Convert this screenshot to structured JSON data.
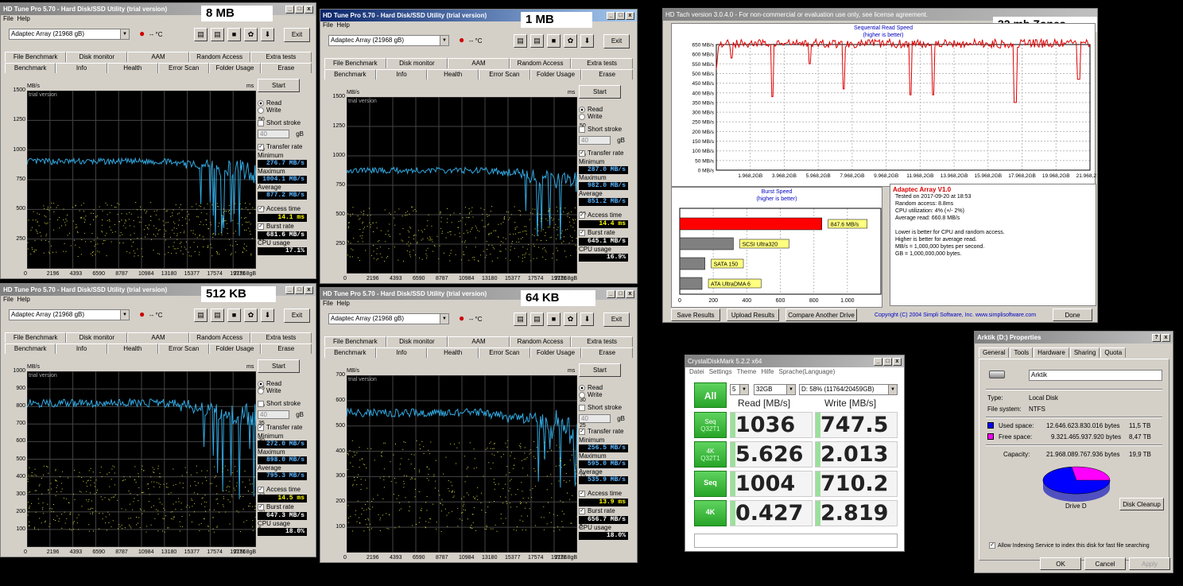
{
  "hdtune": {
    "menu_file": "File",
    "menu_help": "Help",
    "drive_select": "Adaptec Array (21968 gB)",
    "temp": "-- °C",
    "exit_label": "Exit",
    "tabs_top": [
      "File Benchmark",
      "Disk monitor",
      "AAM",
      "Random Access",
      "Extra tests"
    ],
    "tabs_bottom": [
      "Benchmark",
      "Info",
      "Health",
      "Error Scan",
      "Folder Usage",
      "Erase"
    ],
    "start_label": "Start",
    "read_label": "Read",
    "write_label": "Write",
    "short_stroke_label": "Short stroke",
    "stroke_value": "40",
    "stroke_unit": "gB",
    "transfer_rate_label": "Transfer rate",
    "minimum_label": "Minimum",
    "maximum_label": "Maximum",
    "average_label": "Average",
    "access_time_label": "Access time",
    "burst_rate_label": "Burst rate",
    "cpu_usage_label": "CPU usage",
    "trial_text": "trial version",
    "mbs_unit": "MB/s",
    "ms_unit": "ms",
    "x_ticks": [
      "0",
      "2196",
      "4393",
      "6590",
      "8787",
      "10984",
      "13180",
      "15377",
      "17574",
      "19771",
      "21968gB"
    ],
    "windows": [
      {
        "title": "HD Tune Pro 5.70 - Hard Disk/SSD Utility (trial version)",
        "label": "8 MB",
        "y_ticks": [
          "1500",
          "1250",
          "1000",
          "750",
          "500",
          "250"
        ],
        "ms_ticks": [
          "60",
          "50",
          "40",
          "30",
          "20",
          "10"
        ],
        "minimum": "276.7 MB/s",
        "maximum": "1004.1 MB/s",
        "average": "877.2 MB/s",
        "access": "14.1 ms",
        "burst": "681.6 MB/s",
        "cpu": "17.1%"
      },
      {
        "title": "HD Tune Pro 5.70 - Hard Disk/SSD Utility (trial version)",
        "label": "1 MB",
        "y_ticks": [
          "1500",
          "1250",
          "1000",
          "750",
          "500",
          "250"
        ],
        "ms_ticks": [
          "60",
          "50",
          "40",
          "30",
          "20",
          "10"
        ],
        "minimum": "287.0 MB/s",
        "maximum": "982.0 MB/s",
        "average": "851.2 MB/s",
        "access": "14.4 ms",
        "burst": "645.1 MB/s",
        "cpu": "16.9%"
      },
      {
        "title": "HD Tune Pro 5.70 - Hard Disk/SSD Utility (trial version)",
        "label": "512 KB",
        "y_ticks": [
          "1000",
          "900",
          "800",
          "700",
          "600",
          "500",
          "400",
          "300",
          "200",
          "100"
        ],
        "ms_ticks": [
          "50",
          "45",
          "40",
          "35",
          "30",
          "25",
          "20",
          "15",
          "10",
          "5"
        ],
        "minimum": "272.0 MB/s",
        "maximum": "898.0 MB/s",
        "average": "795.3 MB/s",
        "access": "14.5 ms",
        "burst": "647.3 MB/s",
        "cpu": "18.0%"
      },
      {
        "title": "HD Tune Pro 5.70 - Hard Disk/SSD Utility (trial version)",
        "label": "64 KB",
        "y_ticks": [
          "700",
          "600",
          "500",
          "400",
          "300",
          "200",
          "100"
        ],
        "ms_ticks": [
          "35",
          "30",
          "25",
          "20",
          "15",
          "10",
          "5"
        ],
        "minimum": "256.5 MB/s",
        "maximum": "595.0 MB/s",
        "average": "535.9 MB/s",
        "access": "13.9 ms",
        "burst": "656.7 MB/s",
        "cpu": "18.0%"
      }
    ]
  },
  "hdtach": {
    "title": "HD Tach version 3.0.4.0 - For non-commercial or evaluation use only, see license agreement.",
    "label": "32 mb Zones",
    "seq_title": "Sequential Read Speed",
    "seq_sub": "(higher is better)",
    "y_ticks": [
      "650 MB/s",
      "600 MB/s",
      "550 MB/s",
      "500 MB/s",
      "450 MB/s",
      "400 MB/s",
      "350 MB/s",
      "300 MB/s",
      "250 MB/s",
      "200 MB/s",
      "150 MB/s",
      "100 MB/s",
      "50 MB/s",
      "0 MB/s"
    ],
    "x_ticks": [
      "1.968,2GB",
      "3.968,2GB",
      "5.968,2GB",
      "7.968,2GB",
      "9.968,2GB",
      "11.968,2GB",
      "13.968,2GB",
      "15.968,2GB",
      "17.968,2GB",
      "19.968,2GB",
      "21.968,2GB"
    ],
    "burst_title": "Burst Speed",
    "burst_sub": "(higher is better)",
    "burst_bars": [
      {
        "label": "847.6 MB/s",
        "value": 847.6,
        "color": "#ff0000"
      },
      {
        "label": "SCSI Ultra320",
        "value": 320,
        "color": "#808080"
      },
      {
        "label": "SATA 150",
        "value": 150,
        "color": "#808080"
      },
      {
        "label": "ATA UltraDMA 6",
        "value": 133,
        "color": "#808080"
      }
    ],
    "burst_x_ticks": [
      "0",
      "200",
      "400",
      "600",
      "800",
      "1.000"
    ],
    "info_title": "Adaptec Array V1.0",
    "info_lines": [
      "Tested on 2017-09-20 at 18:53",
      "Random access: 8.8ms",
      "CPU utilization: 4% (+/- 2%)",
      "Average read: 660.8 MB/s",
      "",
      "Lower is better for CPU and random access.",
      "Higher is better for average read.",
      "MB/s = 1,000,000 bytes per second.",
      "GB = 1,000,000,000 bytes."
    ],
    "save_label": "Save Results",
    "upload_label": "Upload Results",
    "compare_label": "Compare Another Drive",
    "copyright": "Copyright (C) 2004 Simpli Software, Inc. www.simplisoftware.com",
    "done_label": "Done"
  },
  "cdm": {
    "title": "CrystalDiskMark 5.2.2 x64",
    "menu": [
      "Datei",
      "Settings",
      "Theme",
      "Hilfe",
      "Sprache(Language)"
    ],
    "all_label": "All",
    "count": "5",
    "size": "32GB",
    "drive": "D: 58% (11764/20459GB)",
    "read_header": "Read [MB/s]",
    "write_header": "Write [MB/s]",
    "rows": [
      {
        "label1": "Seq",
        "label2": "Q32T1",
        "read": "1036",
        "write": "747.5"
      },
      {
        "label1": "4K",
        "label2": "Q32T1",
        "read": "5.626",
        "write": "2.013"
      },
      {
        "label1": "Seq",
        "label2": "",
        "read": "1004",
        "write": "710.2"
      },
      {
        "label1": "4K",
        "label2": "",
        "read": "0.427",
        "write": "2.819"
      }
    ]
  },
  "props": {
    "title": "Arktik (D:) Properties",
    "tabs": [
      "General",
      "Tools",
      "Hardware",
      "Sharing",
      "Quota"
    ],
    "name": "Arktik",
    "type_label": "Type:",
    "type_value": "Local Disk",
    "fs_label": "File system:",
    "fs_value": "NTFS",
    "used_label": "Used space:",
    "used_bytes": "12.646.623.830.016 bytes",
    "used_tb": "11,5 TB",
    "free_label": "Free space:",
    "free_bytes": "9.321.465.937.920 bytes",
    "free_tb": "8,47 TB",
    "cap_label": "Capacity:",
    "cap_bytes": "21.968.089.767.936 bytes",
    "cap_tb": "19,9 TB",
    "drive_label": "Drive D",
    "cleanup_label": "Disk Cleanup",
    "index_label": "Allow Indexing Service to index this disk for fast file searching",
    "ok_label": "OK",
    "cancel_label": "Cancel",
    "apply_label": "Apply",
    "used_color": "#0000ff",
    "free_color": "#ff00ff"
  }
}
